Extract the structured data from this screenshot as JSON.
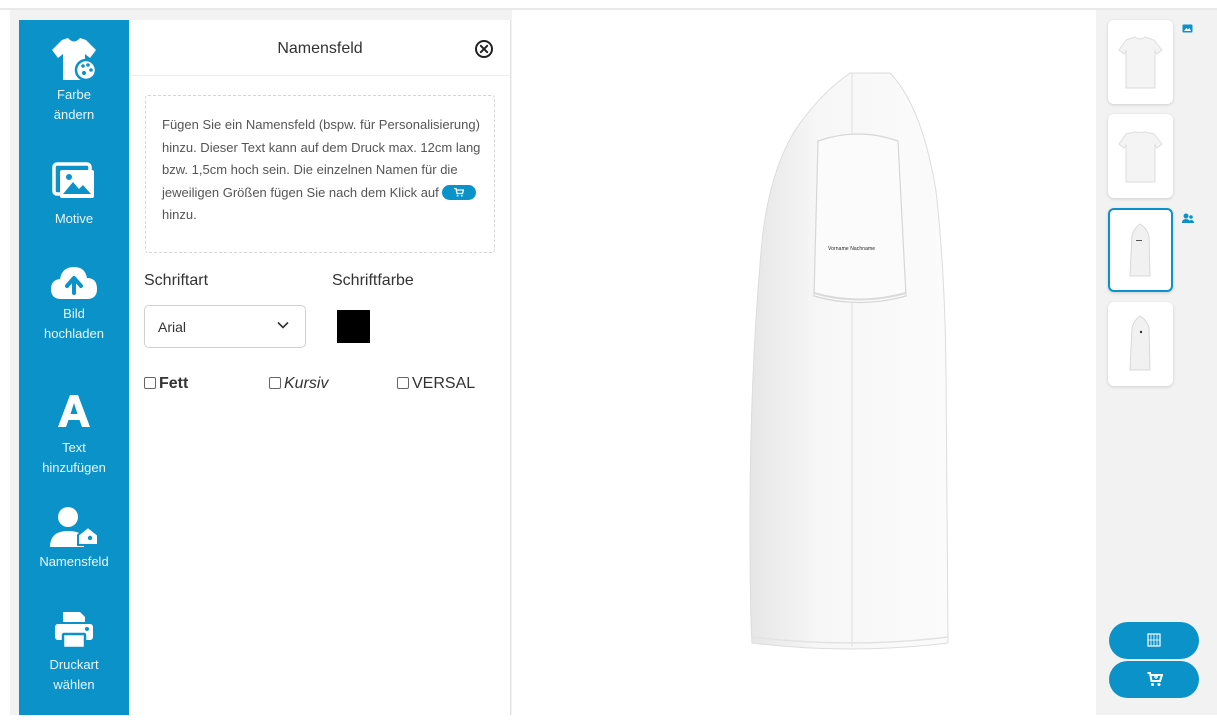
{
  "sidebar": {
    "items": [
      {
        "label_line1": "Farbe",
        "label_line2": "ändern",
        "icon": "tshirt-palette-icon"
      },
      {
        "label_line1": "Motive",
        "label_line2": "",
        "icon": "images-icon"
      },
      {
        "label_line1": "Bild",
        "label_line2": "hochladen",
        "icon": "cloud-upload-icon"
      },
      {
        "label_line1": "Text",
        "label_line2": "hinzufügen",
        "icon": "text-a-icon"
      },
      {
        "label_line1": "Namensfeld",
        "label_line2": "",
        "icon": "user-tag-icon"
      },
      {
        "label_line1": "Druckart",
        "label_line2": "wählen",
        "icon": "printer-icon"
      }
    ]
  },
  "panel": {
    "title": "Namensfeld",
    "info_text_before": "Fügen Sie ein Namensfeld (bspw. für Personalisierung) hinzu. Dieser Text kann auf dem Druck max. 12cm lang bzw. 1,5cm hoch sein. Die einzelnen Namen für die jeweiligen Größen fügen Sie nach dem Klick auf",
    "info_text_after": "hinzu.",
    "font_label": "Schriftart",
    "font_value": "Arial",
    "color_label": "Schriftfarbe",
    "color_value": "#000000",
    "bold_label": "Fett",
    "italic_label": "Kursiv",
    "caps_label": "VERSAL"
  },
  "canvas": {
    "name_text": "Vorname Nachname",
    "product_color": "#ffffff"
  },
  "thumbnails": [
    {
      "view": "front"
    },
    {
      "view": "back"
    },
    {
      "view": "left-side",
      "active": true
    },
    {
      "view": "right-side"
    }
  ],
  "colors": {
    "accent": "#0b93c9"
  }
}
